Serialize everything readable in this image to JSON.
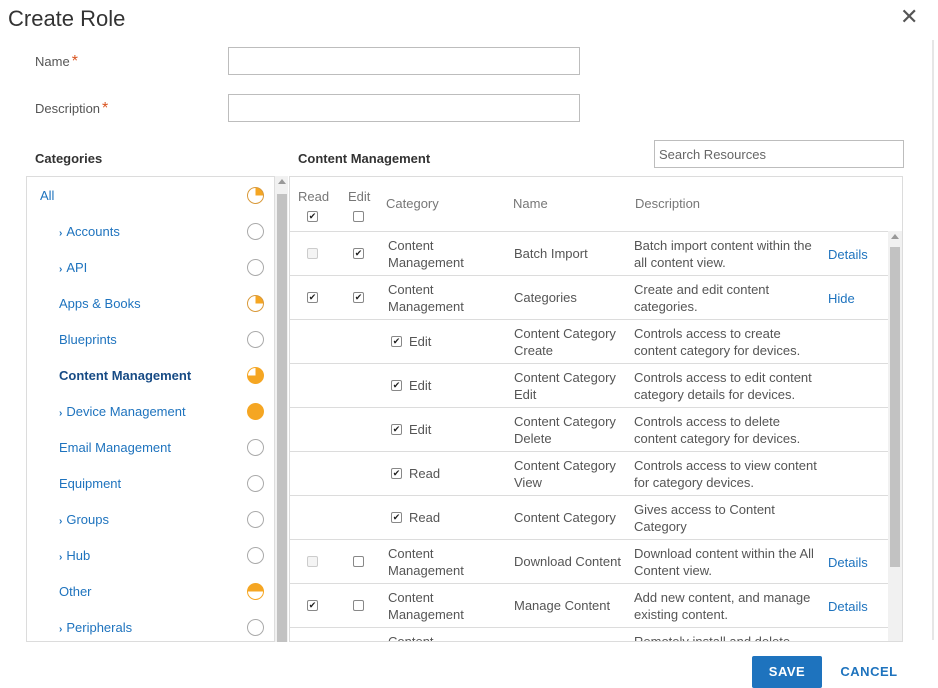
{
  "dialog": {
    "title": "Create Role",
    "close_glyph": "✕"
  },
  "form": {
    "name_label": "Name",
    "description_label": "Description",
    "required_marker": "*",
    "name_value": "",
    "description_value": ""
  },
  "categories": {
    "heading": "Categories",
    "items": [
      {
        "label": "All",
        "expandable": false,
        "status": "quarter",
        "active": false
      },
      {
        "label": "Accounts",
        "expandable": true,
        "status": "empty",
        "active": false
      },
      {
        "label": "API",
        "expandable": true,
        "status": "empty",
        "active": false
      },
      {
        "label": "Apps & Books",
        "expandable": false,
        "status": "quarter",
        "active": false
      },
      {
        "label": "Blueprints",
        "expandable": false,
        "status": "empty",
        "active": false
      },
      {
        "label": "Content Management",
        "expandable": false,
        "status": "three-quarter",
        "active": true
      },
      {
        "label": "Device Management",
        "expandable": true,
        "status": "full",
        "active": false
      },
      {
        "label": "Email Management",
        "expandable": false,
        "status": "empty",
        "active": false
      },
      {
        "label": "Equipment",
        "expandable": false,
        "status": "empty",
        "active": false
      },
      {
        "label": "Groups",
        "expandable": true,
        "status": "empty",
        "active": false
      },
      {
        "label": "Hub",
        "expandable": true,
        "status": "empty",
        "active": false
      },
      {
        "label": "Other",
        "expandable": false,
        "status": "half",
        "active": false
      },
      {
        "label": "Peripherals",
        "expandable": true,
        "status": "empty",
        "active": false
      }
    ]
  },
  "resources": {
    "heading": "Content Management",
    "search_placeholder": "Search Resources",
    "columns": {
      "read": "Read",
      "edit": "Edit",
      "category": "Category",
      "name": "Name",
      "description": "Description"
    },
    "header_read_checked": true,
    "header_edit_checked": false,
    "rows": [
      {
        "kind": "main",
        "read": false,
        "read_disabled": true,
        "edit": true,
        "category": [
          "Content",
          "Management"
        ],
        "name": [
          "Batch Import"
        ],
        "description": [
          "Batch import content within the",
          "all content view."
        ],
        "link": "Details"
      },
      {
        "kind": "main",
        "read": true,
        "read_disabled": false,
        "edit": true,
        "category": [
          "Content",
          "Management"
        ],
        "name": [
          "Categories"
        ],
        "description": [
          "Create and edit content",
          "categories."
        ],
        "link": "Hide"
      },
      {
        "kind": "sub",
        "perm": "Edit",
        "checked": true,
        "name": [
          "Content Category",
          "Create"
        ],
        "description": [
          "Controls access to create",
          "content category for devices."
        ]
      },
      {
        "kind": "sub",
        "perm": "Edit",
        "checked": true,
        "name": [
          "Content Category",
          "Edit"
        ],
        "description": [
          "Controls access to edit content",
          "category details for devices."
        ]
      },
      {
        "kind": "sub",
        "perm": "Edit",
        "checked": true,
        "name": [
          "Content Category",
          "Delete"
        ],
        "description": [
          "Controls access to delete",
          "content category for devices."
        ]
      },
      {
        "kind": "sub",
        "perm": "Read",
        "checked": true,
        "name": [
          "Content Category",
          "View"
        ],
        "description": [
          "Controls access to view content",
          "for category devices."
        ]
      },
      {
        "kind": "sub",
        "perm": "Read",
        "checked": true,
        "name": [
          "Content Category"
        ],
        "description": [
          "Gives access to Content",
          "Category"
        ]
      },
      {
        "kind": "main",
        "read": false,
        "read_disabled": true,
        "edit": false,
        "category": [
          "Content",
          "Management"
        ],
        "name": [
          "Download Content"
        ],
        "description": [
          "Download content within the All",
          "Content view."
        ],
        "link": "Details"
      },
      {
        "kind": "main",
        "read": true,
        "read_disabled": false,
        "edit": false,
        "category": [
          "Content",
          "Management"
        ],
        "name": [
          "Manage Content"
        ],
        "description": [
          "Add new content, and manage",
          "existing content."
        ],
        "link": "Details"
      },
      {
        "kind": "main",
        "read": false,
        "read_disabled": false,
        "edit": false,
        "category": [
          "Content",
          ""
        ],
        "name": [
          ""
        ],
        "description": [
          "Remotely install and delete",
          ""
        ],
        "link": ""
      }
    ]
  },
  "footer": {
    "save_label": "SAVE",
    "cancel_label": "CANCEL"
  }
}
